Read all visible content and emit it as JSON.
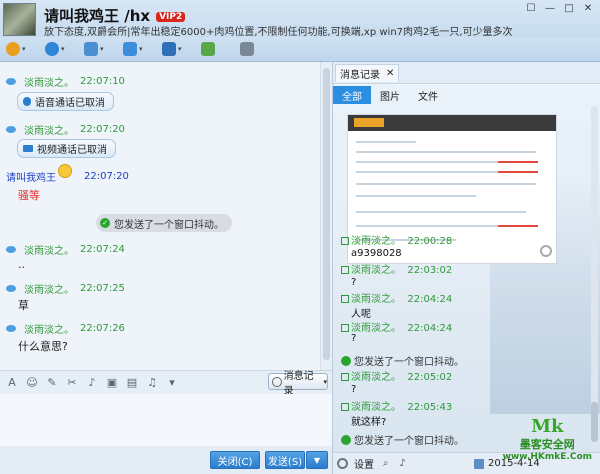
{
  "header": {
    "title": "请叫我鸡王 /hx",
    "vip": "VIP2",
    "signature": "放下态度,双爵会所|常年出稳定6000+肉鸡位置,不限制任何功能,可换端,xp win7肉鸡2毛一只,可少量多次"
  },
  "toolbar": {
    "icons": [
      "mic-icon",
      "camera-icon",
      "screen-share-icon",
      "folder-icon",
      "desktop-icon",
      "app-icon",
      "more-icon"
    ]
  },
  "messages": [
    {
      "name": "淡雨淡之。",
      "time": "22:07:10",
      "type": "bubble",
      "text": "语音通话已取消",
      "icon": "mic"
    },
    {
      "name": "淡雨淡之。",
      "time": "22:07:20",
      "type": "bubble",
      "text": "视频通话已取消",
      "icon": "camera"
    },
    {
      "name": "请叫我鸡王",
      "time": "22:07:20",
      "type": "text",
      "text": "骚等"
    },
    {
      "type": "system",
      "text": "您发送了一个窗口抖动。"
    },
    {
      "name": "淡雨淡之。",
      "time": "22:07:24",
      "type": "text",
      "text": ".."
    },
    {
      "name": "淡雨淡之。",
      "time": "22:07:25",
      "type": "text",
      "text": "草"
    },
    {
      "name": "淡雨淡之。",
      "time": "22:07:26",
      "type": "text",
      "text": "什么意思?"
    }
  ],
  "input_toolbar": {
    "history_label": "消息记录"
  },
  "buttons": {
    "close": "关闭(C)",
    "send": "发送(S)"
  },
  "right_pane": {
    "tab_title": "消息记录",
    "filters": [
      "全部",
      "图片",
      "文件"
    ],
    "messages": [
      {
        "name": "淡雨淡之。",
        "time": "22:00:28",
        "text": "a9398028"
      },
      {
        "name": "淡雨淡之。",
        "time": "22:03:02",
        "text": "?"
      },
      {
        "name": "淡雨淡之。",
        "time": "22:04:24",
        "text": "人呢"
      },
      {
        "name": "淡雨淡之。",
        "time": "22:04:24",
        "text": "?"
      },
      {
        "system": "您发送了一个窗口抖动。"
      },
      {
        "name": "淡雨淡之。",
        "time": "22:05:02",
        "text": "?"
      },
      {
        "name": "淡雨淡之。",
        "time": "22:05:43",
        "text": "就这样?"
      },
      {
        "system": "您发送了一个窗口抖动。"
      }
    ],
    "footer": {
      "settings": "设置",
      "date": "2015-4-14"
    }
  },
  "watermark": {
    "mk": "Mk",
    "cn": "墨客安全网",
    "url": "www.HKmkE.Com"
  }
}
